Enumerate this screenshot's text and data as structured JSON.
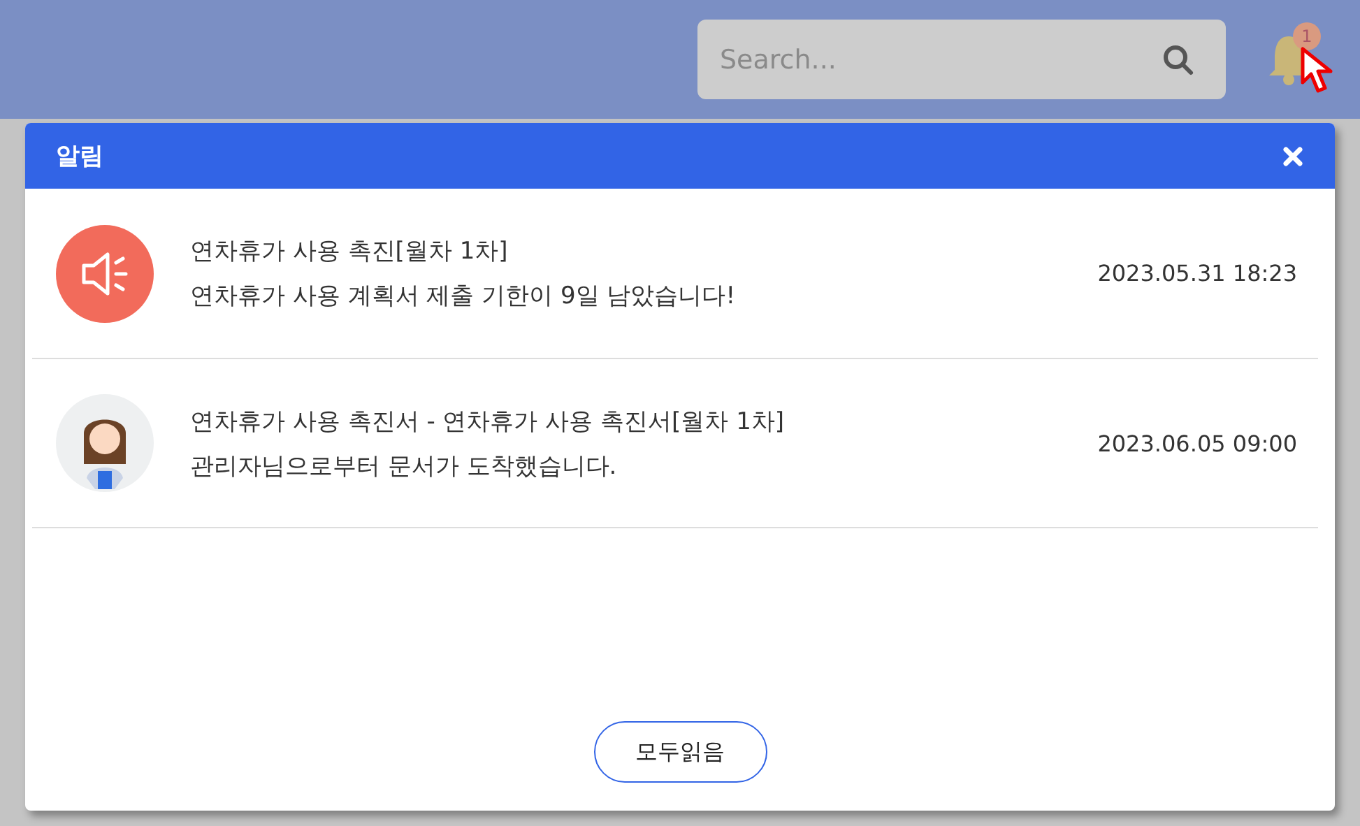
{
  "header": {
    "search": {
      "placeholder": "Search..."
    },
    "bell": {
      "badge": "1"
    }
  },
  "popup": {
    "title": "알림",
    "notifications": [
      {
        "kind": "announcement",
        "title": "연차휴가 사용 촉진[월차 1차]",
        "message": "연차휴가 사용 계획서 제출 기한이 9일 남았습니다!",
        "time": "2023.05.31 18:23"
      },
      {
        "kind": "avatar",
        "title": "연차휴가 사용 촉진서 - 연차휴가 사용 촉진서[월차 1차]",
        "message": "관리자님으로부터 문서가 도착했습니다.",
        "time": "2023.06.05 09:00"
      }
    ],
    "button": "모두읽음"
  }
}
